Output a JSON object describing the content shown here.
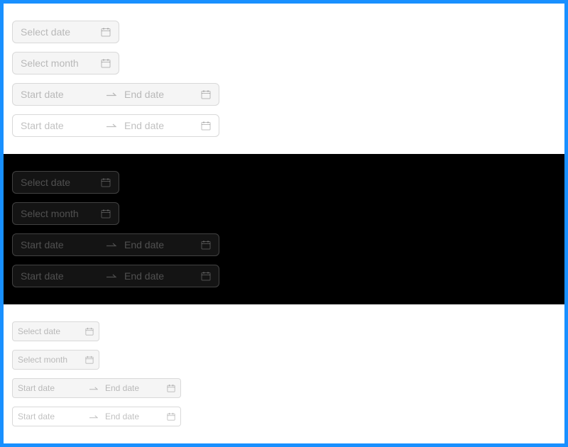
{
  "sections": [
    {
      "theme": "light",
      "select_date": "Select date",
      "select_month": "Select month",
      "range_disabled": {
        "start": "Start date",
        "end": "End date"
      },
      "range_enabled": {
        "start": "Start date",
        "end": "End date"
      }
    },
    {
      "theme": "dark",
      "select_date": "Select date",
      "select_month": "Select month",
      "range_disabled": {
        "start": "Start date",
        "end": "End date"
      },
      "range_enabled": {
        "start": "Start date",
        "end": "End date"
      }
    },
    {
      "theme": "light-small",
      "select_date": "Select date",
      "select_month": "Select month",
      "range_disabled": {
        "start": "Start date",
        "end": "End date"
      },
      "range_enabled": {
        "start": "Start date",
        "end": "End date"
      }
    }
  ],
  "icons": {
    "calendar": "calendar-icon",
    "arrow": "swap-right-icon"
  },
  "colors": {
    "frame": "#1890ff",
    "dark_bg": "#000000",
    "disabled_bg": "#f5f5f5"
  }
}
